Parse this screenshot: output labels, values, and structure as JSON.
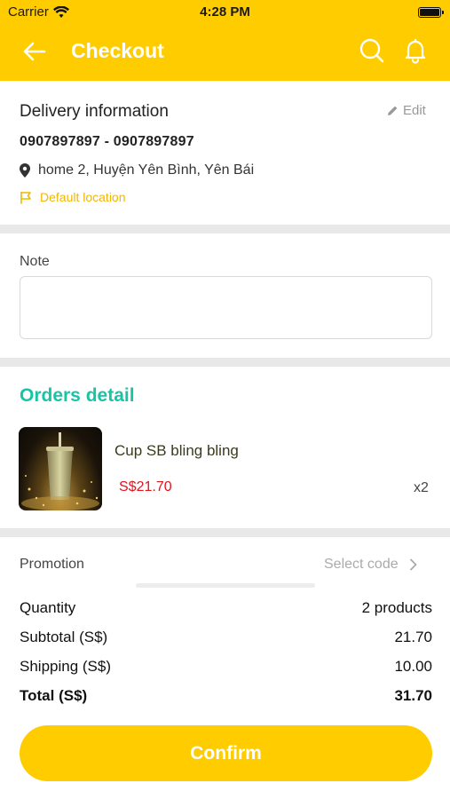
{
  "status_bar": {
    "carrier": "Carrier",
    "time": "4:28 PM"
  },
  "nav": {
    "title": "Checkout"
  },
  "delivery": {
    "title": "Delivery information",
    "edit_label": "Edit",
    "phone": "0907897897 - 0907897897",
    "address": "home 2, Huyện Yên Bình, Yên Bái",
    "default_location": "Default location"
  },
  "note": {
    "label": "Note",
    "value": "",
    "placeholder": ""
  },
  "orders": {
    "title": "Orders detail",
    "items": [
      {
        "name": "Cup SB bling bling",
        "price": "S$21.70",
        "quantity": "x2"
      }
    ]
  },
  "promotion": {
    "label": "Promotion",
    "select_label": "Select code"
  },
  "summary": {
    "quantity_label": "Quantity",
    "quantity_value": "2 products",
    "subtotal_label": "Subtotal (S$)",
    "subtotal_value": "21.70",
    "shipping_label": "Shipping (S$)",
    "shipping_value": "10.00",
    "total_label": "Total (S$)",
    "total_value": "31.70"
  },
  "confirm_label": "Confirm",
  "colors": {
    "brand": "#ffcc00",
    "accent_teal": "#19c4a6",
    "price_red": "#e0151e",
    "default_location": "#f0b800"
  },
  "icons": [
    "wifi-icon",
    "battery-icon",
    "back-arrow-icon",
    "search-icon",
    "bell-icon",
    "pencil-icon",
    "location-pin-icon",
    "flag-icon",
    "chevron-right-icon"
  ]
}
